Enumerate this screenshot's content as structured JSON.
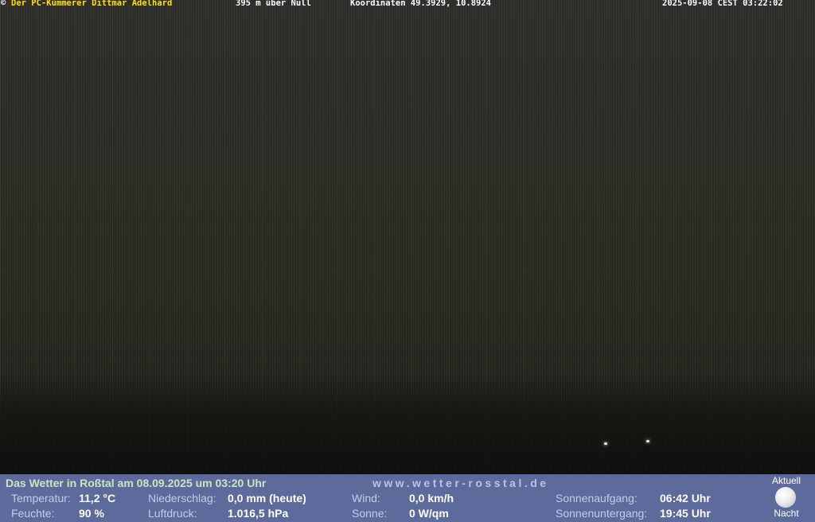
{
  "overlay": {
    "copyright_symbol": "©",
    "owner": "Der PC-Kümmerer Dittmar Adelhard",
    "altitude": "395 m über Null",
    "coordinates": "Koordinaten 49.3929, 10.8924",
    "timestamp": "2025-09-08 CEST 03:22:02"
  },
  "weather": {
    "heading": "Das Wetter in Roßtal am 08.09.2025 um 03:20 Uhr",
    "site": "www.wetter-rosstal.de",
    "temperature_label": "Temperatur:",
    "temperature_value": "11,2 °C",
    "humidity_label": "Feuchte:",
    "humidity_value": "90 %",
    "precip_label": "Niederschlag:",
    "precip_value": "0,0 mm (heute)",
    "pressure_label": "Luftdruck:",
    "pressure_value": "1.016,5 hPa",
    "wind_label": "Wind:",
    "wind_value": "0,0 km/h",
    "sun_label": "Sonne:",
    "sun_value": "0 W/qm",
    "sunrise_label": "Sonnenaufgang:",
    "sunrise_value": "06:42 Uhr",
    "sunset_label": "Sonnenuntergang:",
    "sunset_value": "19:45 Uhr"
  },
  "moon": {
    "top_label": "Aktuell",
    "bottom_label": "Nacht",
    "icon": "moon-icon"
  },
  "colors": {
    "info_bar": "#5d6a9c",
    "owner_text": "#ffe000",
    "heading_text": "#c8e6c0"
  }
}
